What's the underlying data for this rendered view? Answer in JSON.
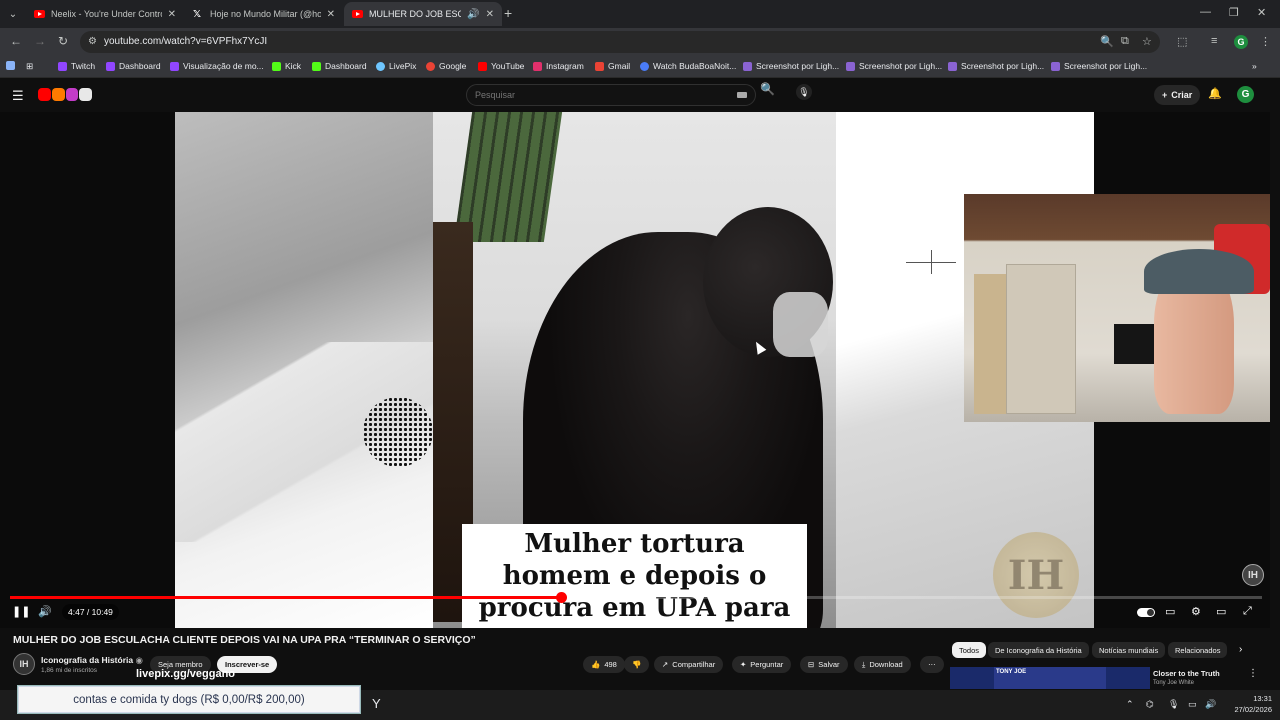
{
  "browser": {
    "tabs": [
      {
        "title": "Neelix - You're Under Control (",
        "favicon": "youtube-icon",
        "active": false
      },
      {
        "title": "Hoje no Mundo Militar (@hoje",
        "favicon": "x-icon",
        "active": false
      },
      {
        "title": "MULHER DO JOB ESCULAC",
        "favicon": "youtube-icon",
        "active": true
      }
    ],
    "url": "youtube.com/watch?v=6VPFhx7YcJI",
    "bookmarks": [
      {
        "label": "Twitch",
        "color": "#9146ff"
      },
      {
        "label": "Dashboard",
        "color": "#9146ff"
      },
      {
        "label": "Visualização de mo...",
        "color": "#9146ff"
      },
      {
        "label": "Kick",
        "color": "#53fc18"
      },
      {
        "label": "Dashboard",
        "color": "#53fc18"
      },
      {
        "label": "LivePix",
        "color": "#6ec6ff"
      },
      {
        "label": "Google",
        "color": "#ea4335"
      },
      {
        "label": "YouTube",
        "color": "#ff0000"
      },
      {
        "label": "Instagram",
        "color": "#e1306c"
      },
      {
        "label": "Gmail",
        "color": "#ea4335"
      },
      {
        "label": "Watch BudaBoaNoit...",
        "color": "#4a7cf7"
      },
      {
        "label": "Screenshot por Ligh...",
        "color": "#8a63d2"
      },
      {
        "label": "Screenshot por Ligh...",
        "color": "#8a63d2"
      },
      {
        "label": "Screenshot por Ligh...",
        "color": "#8a63d2"
      },
      {
        "label": "Screenshot por Ligh...",
        "color": "#8a63d2"
      }
    ],
    "profile_initial": "G"
  },
  "youtube": {
    "search_placeholder": "Pesquisar",
    "create_label": "Criar",
    "avatar_initial": "G"
  },
  "player": {
    "caption": "Mulher tortura homem e depois o procura em UPA para “terminar serviço”",
    "time": "4:47 / 10:49",
    "progress_fraction": 0.44,
    "watermark": "IH"
  },
  "video": {
    "title": "MULHER DO JOB ESCULACHA CLIENTE DEPOIS VAI NA UPA PRA “TERMINAR O SERVIÇO”",
    "channel": "Iconografia da História",
    "channel_initials": "IH",
    "subscribers": "1,86 mi de inscritos",
    "join_label": "Seja membro",
    "subscribe_label": "Inscrever-se",
    "likes": "498",
    "share_label": "Compartilhar",
    "ask_label": "Perguntar",
    "save_label": "Salvar",
    "download_label": "Download"
  },
  "overlay": {
    "livepix_text": "livepix.gg/veggano",
    "goal_text": "contas e comida ty dogs (R$ 0,00/R$ 200,00)"
  },
  "sidebar": {
    "chips": [
      "Todos",
      "De Iconografia da História",
      "Notícias mundiais",
      "Relacionados"
    ],
    "rec_title": "Closer to the Truth",
    "rec_channel": "Tony Joe White",
    "rec_thumb_text": "TONY JOE"
  },
  "taskbar": {
    "time": "13:31",
    "date": "27/02/2026"
  }
}
